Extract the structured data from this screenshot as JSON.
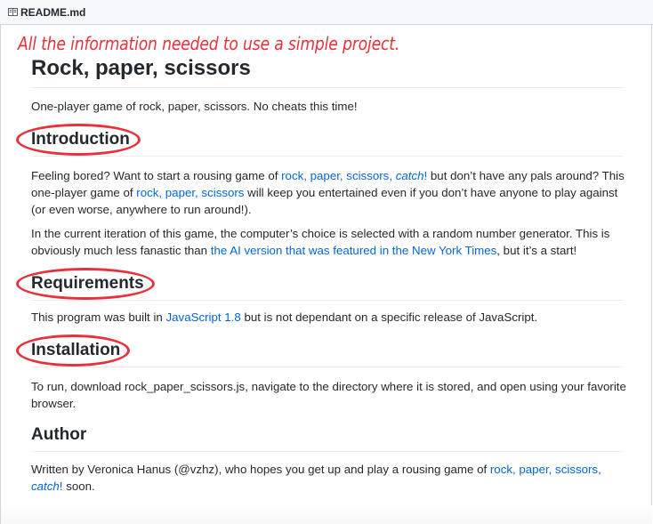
{
  "file_header": {
    "icon": "book-icon",
    "filename": "README.md"
  },
  "annotation": {
    "text": "All the information needed to use a simple project.",
    "color": "#e8323b"
  },
  "readme": {
    "title": "Rock, paper, scissors",
    "tagline": "One-player game of rock, paper, scissors. No cheats this time!",
    "introduction": {
      "heading": "Introduction",
      "p1_part1": "Feeling bored? Want to start a rousing game of ",
      "p1_link1": "rock, paper, scissors,",
      "p1_link1_catch": "catch",
      "p1_link1_end": "!",
      "p1_part2": " but don’t have any pals around? This one-player game of ",
      "p1_link2": "rock, paper, scissors",
      "p1_part3": " will keep you entertained even if you don’t have anyone to play against (or even worse, anywhere to run around!).",
      "p2_part1": "In the current iteration of this game, the computer’s choice is selected with a random number generator. This is obviously much less fanastic than ",
      "p2_link": "the AI version that was featured in the New York Times",
      "p2_part2": ", but it’s a start!"
    },
    "requirements": {
      "heading": "Requirements",
      "part1": "This program was built in ",
      "link": "JavaScript 1.8",
      "part2": " but is not dependant on a specific release of JavaScript."
    },
    "installation": {
      "heading": "Installation",
      "text": "To run, download rock_paper_scissors.js, navigate to the directory where it is stored, and open using your favorite browser."
    },
    "author": {
      "heading": "Author",
      "part1": "Written by Veronica Hanus (@vzhz), who hopes you get up and play a rousing game of ",
      "link": "rock, paper, scissors,",
      "link_catch": "catch",
      "link_end": "!",
      "part2": " soon."
    }
  },
  "colors": {
    "link": "#0366d6",
    "text": "#24292e",
    "annotation": "#e8323b",
    "header_bg": "#f6f8fa"
  }
}
